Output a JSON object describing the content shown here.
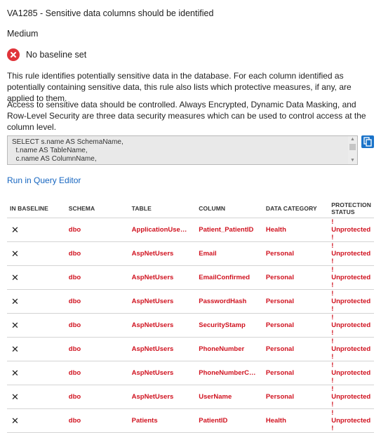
{
  "rule": {
    "title": "VA1285 - Sensitive data columns should be identified",
    "severity": "Medium",
    "status_text": "No baseline set",
    "description_1": "This rule identifies potentially sensitive data in the database. For each column identified as potentially containing sensitive data, this rule also lists which protective measures, if any, are applied to them.",
    "description_2": "Access to sensitive data should be controlled. Always Encrypted, Dynamic Data Masking, and Row-Level Security are three data security measures which can be used to control access at the column level."
  },
  "query": {
    "lines": [
      "SELECT s.name AS SchemaName,",
      "  t.name AS TableName,",
      "  c.name AS ColumnName,"
    ],
    "run_link": "Run in Query Editor"
  },
  "colors": {
    "accent": "#1565c0",
    "error": "#d0121f",
    "status_icon": "#e0343a"
  },
  "table": {
    "headers": [
      "IN BASELINE",
      "SCHEMA",
      "TABLE",
      "COLUMN",
      "DATA CATEGORY",
      "PROTECTION STATUS"
    ],
    "rows": [
      {
        "baseline": "✕",
        "schema": "dbo",
        "table": "ApplicationUserP...",
        "column": "Patient_PatientID",
        "category": "Health",
        "status": "! Unprotected !"
      },
      {
        "baseline": "✕",
        "schema": "dbo",
        "table": "AspNetUsers",
        "column": "Email",
        "category": "Personal",
        "status": "! Unprotected !"
      },
      {
        "baseline": "✕",
        "schema": "dbo",
        "table": "AspNetUsers",
        "column": "EmailConfirmed",
        "category": "Personal",
        "status": "! Unprotected !"
      },
      {
        "baseline": "✕",
        "schema": "dbo",
        "table": "AspNetUsers",
        "column": "PasswordHash",
        "category": "Personal",
        "status": "! Unprotected !"
      },
      {
        "baseline": "✕",
        "schema": "dbo",
        "table": "AspNetUsers",
        "column": "SecurityStamp",
        "category": "Personal",
        "status": "! Unprotected !"
      },
      {
        "baseline": "✕",
        "schema": "dbo",
        "table": "AspNetUsers",
        "column": "PhoneNumber",
        "category": "Personal",
        "status": "! Unprotected !"
      },
      {
        "baseline": "✕",
        "schema": "dbo",
        "table": "AspNetUsers",
        "column": "PhoneNumberCo...",
        "category": "Personal",
        "status": "! Unprotected !"
      },
      {
        "baseline": "✕",
        "schema": "dbo",
        "table": "AspNetUsers",
        "column": "UserName",
        "category": "Personal",
        "status": "! Unprotected !"
      },
      {
        "baseline": "✕",
        "schema": "dbo",
        "table": "Patients",
        "column": "PatientID",
        "category": "Health",
        "status": "! Unprotected !"
      }
    ]
  }
}
